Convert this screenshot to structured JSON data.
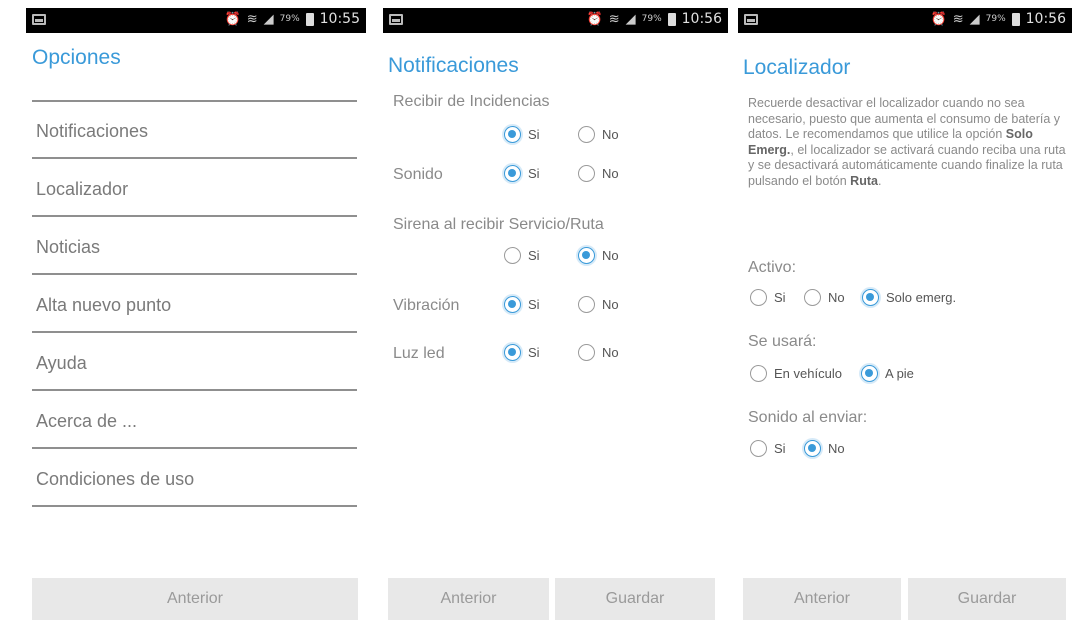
{
  "screen1": {
    "status": {
      "battery": "79%",
      "time": "10:55"
    },
    "title": "Opciones",
    "menu": [
      "Notificaciones",
      "Localizador",
      "Noticias",
      "Alta nuevo punto",
      "Ayuda",
      "Acerca de ...",
      "Condiciones de uso"
    ],
    "btn_prev": "Anterior"
  },
  "screen2": {
    "status": {
      "battery": "79%",
      "time": "10:56"
    },
    "title": "Notificaciones",
    "incidencias_label": "Recibir de Incidencias",
    "sonido_label": "Sonido",
    "sirena_label": "Sirena al recibir Servicio/Ruta",
    "vibracion_label": "Vibración",
    "luz_label": "Luz led",
    "si": "Si",
    "no": "No",
    "btn_prev": "Anterior",
    "btn_save": "Guardar"
  },
  "screen3": {
    "status": {
      "battery": "79%",
      "time": "10:56"
    },
    "title": "Localizador",
    "para_1": "Recuerde desactivar el localizador cuando no sea necesario, puesto que aumenta el consumo de batería y datos. Le recomendamos que utilice la opción ",
    "para_b1": "Solo Emerg.",
    "para_2": ", el localizador se activará cuando reciba una ruta y se desactivará automáticamente cuando finalize la ruta pulsando el botón ",
    "para_b2": "Ruta",
    "para_3": ".",
    "activo_label": "Activo:",
    "activo_si": "Si",
    "activo_no": "No",
    "activo_solo": "Solo emerg.",
    "usara_label": "Se usará:",
    "usara_vehiculo": "En vehículo",
    "usara_pie": "A pie",
    "sonido_label": "Sonido al enviar:",
    "sonido_si": "Si",
    "sonido_no": "No",
    "btn_prev": "Anterior",
    "btn_save": "Guardar"
  }
}
